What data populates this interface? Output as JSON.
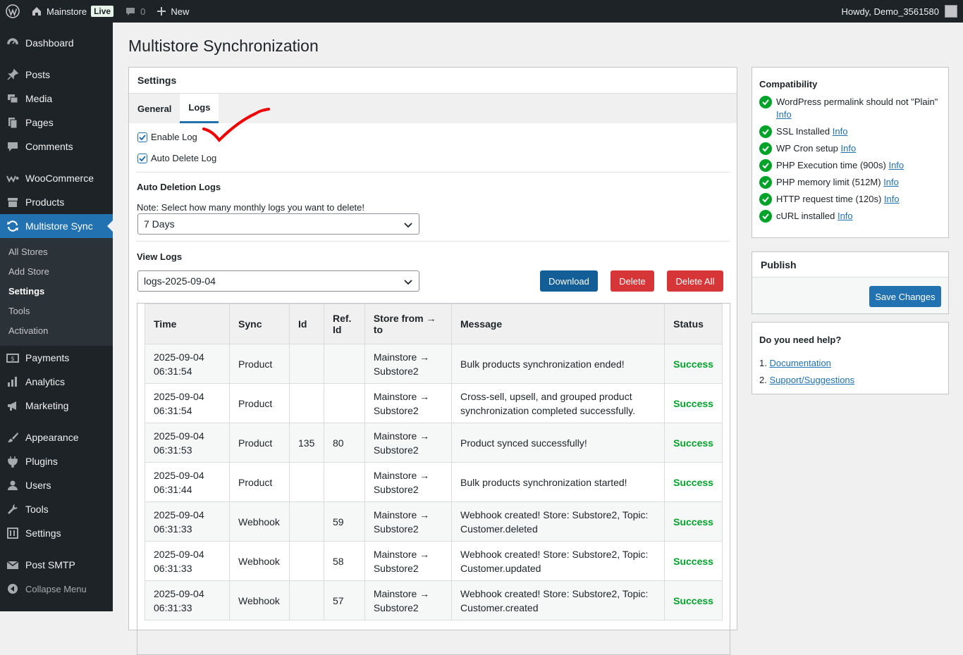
{
  "adminbar": {
    "site_name": "Mainstore",
    "live": "Live",
    "comments_count": "0",
    "new_label": "New",
    "howdy": "Howdy, Demo_3561580"
  },
  "sidebar": {
    "items": [
      {
        "label": "Dashboard",
        "icon": "dashboard-icon"
      },
      {
        "label": "Posts",
        "icon": "pin-icon"
      },
      {
        "label": "Media",
        "icon": "media-icon"
      },
      {
        "label": "Pages",
        "icon": "pages-icon"
      },
      {
        "label": "Comments",
        "icon": "comment-icon"
      },
      {
        "label": "WooCommerce",
        "icon": "woocommerce-icon"
      },
      {
        "label": "Products",
        "icon": "archive-icon"
      },
      {
        "label": "Multistore Sync",
        "icon": "sync-icon"
      },
      {
        "label": "Payments",
        "icon": "payments-icon"
      },
      {
        "label": "Analytics",
        "icon": "bar-chart-icon"
      },
      {
        "label": "Marketing",
        "icon": "megaphone-icon"
      },
      {
        "label": "Appearance",
        "icon": "brush-icon"
      },
      {
        "label": "Plugins",
        "icon": "plugin-icon"
      },
      {
        "label": "Users",
        "icon": "user-icon"
      },
      {
        "label": "Tools",
        "icon": "wrench-icon"
      },
      {
        "label": "Settings",
        "icon": "settings-icon"
      },
      {
        "label": "Post SMTP",
        "icon": "mail-icon"
      }
    ],
    "submenu": [
      "All Stores",
      "Add Store",
      "Settings",
      "Tools",
      "Activation"
    ],
    "collapse": "Collapse Menu"
  },
  "page": {
    "title": "Multistore Synchronization",
    "box_title": "Settings",
    "tabs": [
      "General",
      "Logs"
    ],
    "enable_log": "Enable Log",
    "auto_delete_log": "Auto Delete Log",
    "auto_deletion_heading": "Auto Deletion Logs",
    "note": "Note: Select how many monthly logs you want to delete!",
    "deletion_value": "7 Days",
    "view_logs_heading": "View Logs",
    "logs_value": "logs-2025-09-04",
    "download": "Download",
    "delete": "Delete",
    "delete_all": "Delete All"
  },
  "table": {
    "headers": [
      "Time",
      "Sync",
      "Id",
      "Ref. Id",
      "Store from → to",
      "Message",
      "Status"
    ],
    "rows": [
      {
        "time": "2025-09-04 06:31:54",
        "sync": "Product",
        "id": "",
        "ref": "",
        "store": "Mainstore → Substore2",
        "message": "Bulk products synchronization ended!",
        "status": "Success"
      },
      {
        "time": "2025-09-04 06:31:54",
        "sync": "Product",
        "id": "",
        "ref": "",
        "store": "Mainstore → Substore2",
        "message": "Cross-sell, upsell, and grouped product synchronization completed successfully.",
        "status": "Success"
      },
      {
        "time": "2025-09-04 06:31:53",
        "sync": "Product",
        "id": "135",
        "ref": "80",
        "store": "Mainstore → Substore2",
        "message": "Product synced successfully!",
        "status": "Success"
      },
      {
        "time": "2025-09-04 06:31:44",
        "sync": "Product",
        "id": "",
        "ref": "",
        "store": "Mainstore → Substore2",
        "message": "Bulk products synchronization started!",
        "status": "Success"
      },
      {
        "time": "2025-09-04 06:31:33",
        "sync": "Webhook",
        "id": "",
        "ref": "59",
        "store": "Mainstore → Substore2",
        "message": "Webhook created! Store: Substore2, Topic: Customer.deleted",
        "status": "Success"
      },
      {
        "time": "2025-09-04 06:31:33",
        "sync": "Webhook",
        "id": "",
        "ref": "58",
        "store": "Mainstore → Substore2",
        "message": "Webhook created! Store: Substore2, Topic: Customer.updated",
        "status": "Success"
      },
      {
        "time": "2025-09-04 06:31:33",
        "sync": "Webhook",
        "id": "",
        "ref": "57",
        "store": "Mainstore → Substore2",
        "message": "Webhook created! Store: Substore2, Topic: Customer.created",
        "status": "Success"
      }
    ]
  },
  "compat": {
    "title": "Compatibility",
    "link": "Info",
    "items": [
      "WordPress permalink should not \"Plain\"",
      "SSL Installed",
      "WP Cron setup",
      "PHP Execution time (900s)",
      "PHP memory limit (512M)",
      "HTTP request time (120s)",
      "cURL installed"
    ]
  },
  "publish": {
    "title": "Publish",
    "save": "Save Changes"
  },
  "help": {
    "title": "Do you need help?",
    "links": [
      "1. ",
      "Documentation",
      "2. ",
      "Support/Suggestions"
    ]
  },
  "colors": {
    "accent": "#2271b1",
    "danger": "#d63638",
    "success": "#00a32a",
    "admin_dark": "#1d2327"
  }
}
